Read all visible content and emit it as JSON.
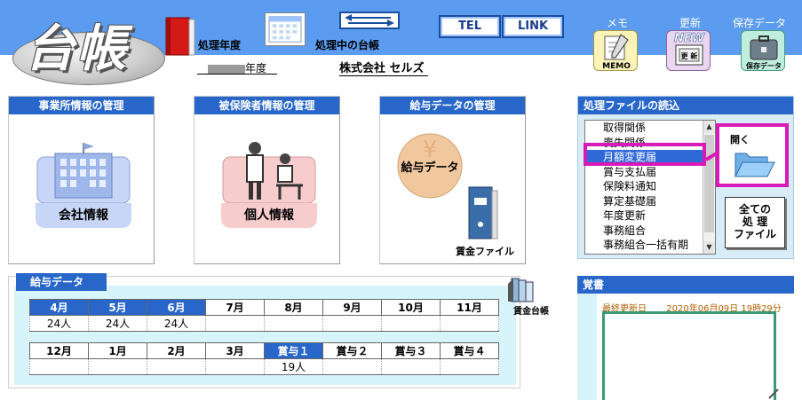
{
  "header": {
    "logo_text": "台帳",
    "processing_year_label": "処理年度",
    "current_ledger_label": "処理中の台帳",
    "tel_label": "TEL",
    "link_label": "LINK",
    "memo": {
      "top_label": "メモ",
      "icon_label": "MEMO"
    },
    "update": {
      "top_label": "更新",
      "badge": "NEW",
      "icon_label": "更 新"
    },
    "save_data": {
      "top_label": "保存データ",
      "icon_label": "保存データ"
    },
    "year_suffix": "年度",
    "company_name": "株式会社 セルズ"
  },
  "panels": {
    "office": {
      "title": "事業所情報の管理",
      "button_label": "会社情報"
    },
    "insured": {
      "title": "被保険者情報の管理",
      "button_label": "個人情報"
    },
    "salary": {
      "title": "給与データの管理",
      "salary_button_label": "給与データ",
      "wage_file_label": "賃金ファイル"
    }
  },
  "file_panel": {
    "title": "処理ファイルの読込",
    "items": [
      "取得関係",
      "喪失関係",
      "月額変更届",
      "賞与支払届",
      "保険料通知",
      "算定基礎届",
      "年度更新",
      "事務組合",
      "事務組合一括有期"
    ],
    "selected_index": 2,
    "open_label": "開く",
    "all_files_label": [
      "全ての",
      "処 理",
      "ファイル"
    ]
  },
  "salary_data": {
    "tab_label": "給与データ",
    "row1": {
      "headers": [
        "4月",
        "5月",
        "6月",
        "7月",
        "8月",
        "9月",
        "10月",
        "11月"
      ],
      "values": [
        "24人",
        "24人",
        "24人",
        "",
        "",
        "",
        "",
        ""
      ],
      "active": [
        true,
        true,
        true,
        false,
        false,
        false,
        false,
        false
      ]
    },
    "row2": {
      "headers": [
        "12月",
        "1月",
        "2月",
        "3月",
        "賞与１",
        "賞与２",
        "賞与３",
        "賞与４"
      ],
      "values": [
        "",
        "",
        "",
        "",
        "19人",
        "",
        "",
        ""
      ],
      "active": [
        false,
        false,
        false,
        false,
        true,
        false,
        false,
        false
      ]
    },
    "wage_book_label": "賃金台帳"
  },
  "notes": {
    "title": "覚書",
    "last_updated_label": "最終更新日",
    "last_updated_value": "2020年06月09日 19時29分"
  },
  "colors": {
    "header_blue": "#5b9bf0",
    "title_blue": "#2866c9",
    "highlight_magenta": "#d81ab8",
    "panel_cyan": "#d8f4fb"
  }
}
